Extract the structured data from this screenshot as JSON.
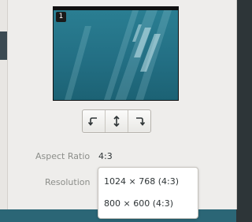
{
  "monitor": {
    "number": "1"
  },
  "rotate": {
    "left_icon": "rotate-left-icon",
    "flip_icon": "flip-vertical-icon",
    "right_icon": "rotate-right-icon"
  },
  "aspect_ratio": {
    "label": "Aspect Ratio",
    "value": "4:3"
  },
  "resolution": {
    "label": "Resolution",
    "options": [
      "1024 × 768 (4:3)",
      "800 × 600 (4:3)"
    ]
  },
  "colors": {
    "dialog_bg": "#eeedeb",
    "preview_teal": "#236f84",
    "desktop_bg": "#2d3538",
    "text_primary": "#2e3436",
    "text_dim": "#8c8e8a"
  }
}
